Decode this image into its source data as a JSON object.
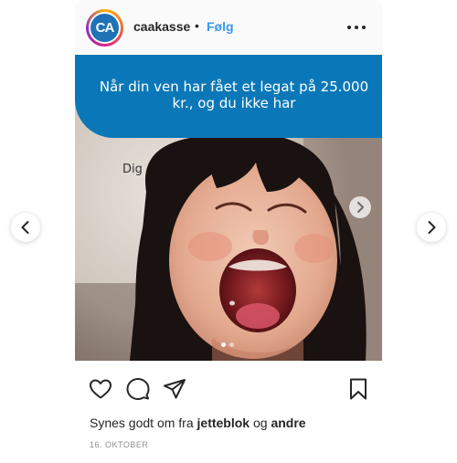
{
  "post": {
    "username": "caakasse",
    "separator": "•",
    "follow_label": "Følg",
    "avatar_text": "CA",
    "more_icon": "more-horizontal-icon",
    "image": {
      "banner_text": "Når din ven har fået et legat på 25.000 kr., og du ikke har",
      "label": "Dig",
      "carousel_index": 1,
      "carousel_total": 2
    },
    "actions": {
      "like_icon": "heart-icon",
      "comment_icon": "comment-icon",
      "share_icon": "paper-plane-icon",
      "save_icon": "bookmark-icon"
    },
    "likes": {
      "prefix": "Synes godt om fra",
      "user1": "jetteblok",
      "conjunction": "og",
      "user2": "andre"
    },
    "date": "16. OKTOBER"
  },
  "colors": {
    "banner_blue": "#0a78b8",
    "follow_blue": "#3897f0",
    "avatar_blue": "#1f72b6",
    "text": "#262626",
    "muted": "#8e8e8e"
  },
  "navigation": {
    "prev_icon": "chevron-left-icon",
    "next_icon": "chevron-right-icon"
  }
}
